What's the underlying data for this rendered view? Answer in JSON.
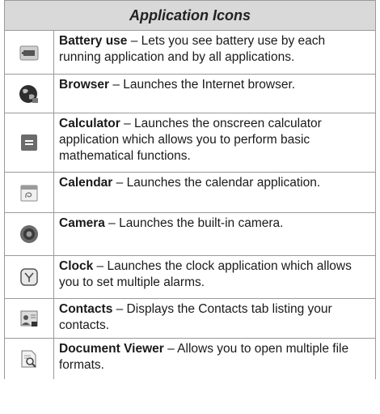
{
  "table": {
    "title": "Application Icons",
    "rows": [
      {
        "icon": "battery-icon",
        "name": "Battery use",
        "desc": " – Lets you see battery use by each running application and by all applications."
      },
      {
        "icon": "browser-globe-icon",
        "name": "Browser",
        "desc": " – Launches the Internet browser."
      },
      {
        "icon": "calculator-icon",
        "name": "Calculator",
        "desc": " – Launches the onscreen calculator application which allows you to perform basic mathematical functions."
      },
      {
        "icon": "calendar-icon",
        "name": "Calendar",
        "desc": " – Launches the calendar application."
      },
      {
        "icon": "camera-icon",
        "name": "Camera",
        "desc": " – Launches the built-in camera."
      },
      {
        "icon": "clock-icon",
        "name": "Clock",
        "desc": " – Launches the clock application which allows you to set multiple alarms."
      },
      {
        "icon": "contacts-icon",
        "name": "Contacts",
        "desc": " – Displays the Contacts tab listing your contacts."
      },
      {
        "icon": "document-viewer-icon",
        "name": "Document Viewer",
        "desc": " – Allows you to open multiple file formats."
      }
    ]
  }
}
